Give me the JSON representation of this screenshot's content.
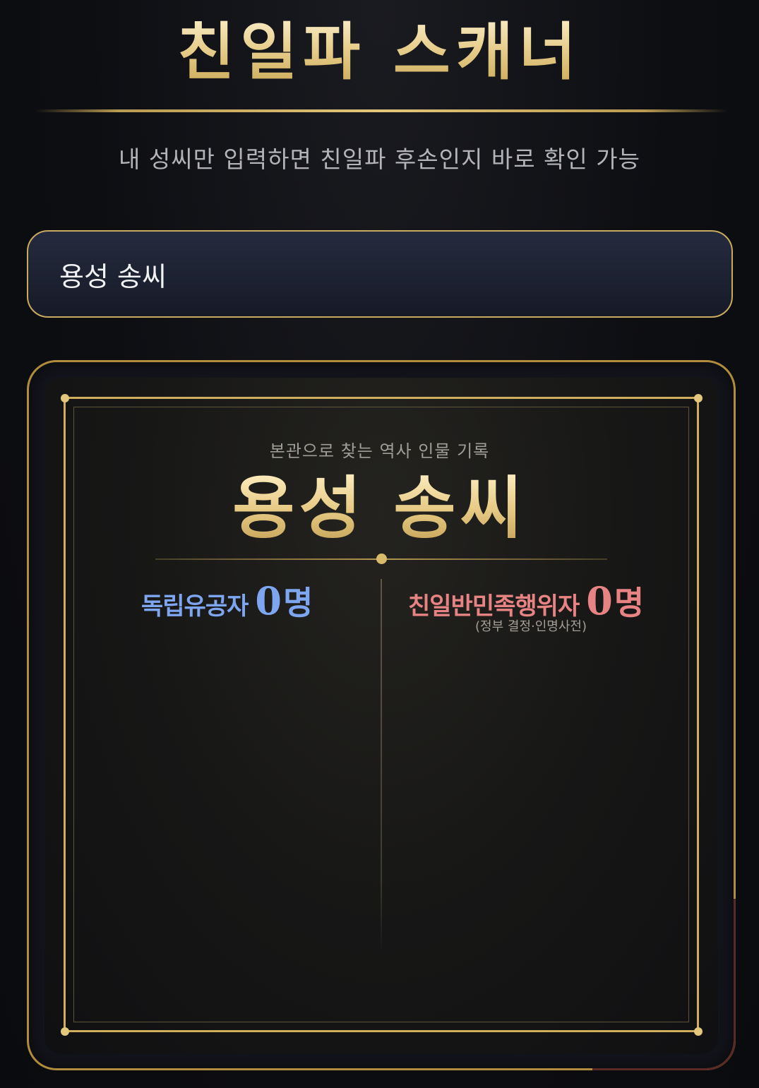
{
  "header": {
    "title": "친일파 스캐너",
    "subtitle": "내 성씨만 입력하면 친일파 후손인지 바로 확인 가능"
  },
  "search": {
    "value": "용성 송씨",
    "placeholder": ""
  },
  "result_card": {
    "kicker": "본관으로 찾는 역사 인물 기록",
    "clan_name": "용성 송씨",
    "independence": {
      "label": "독립유공자",
      "count": "0",
      "unit": "명"
    },
    "collaborator": {
      "label": "친일반민족행위자",
      "count": "0",
      "unit": "명",
      "source": "(정부 결정·인명사전)"
    }
  },
  "colors": {
    "gold": "#e2c679",
    "independence_blue": "#7ea6f0",
    "collaborator_red": "#e88383",
    "background": "#0d0e12"
  }
}
